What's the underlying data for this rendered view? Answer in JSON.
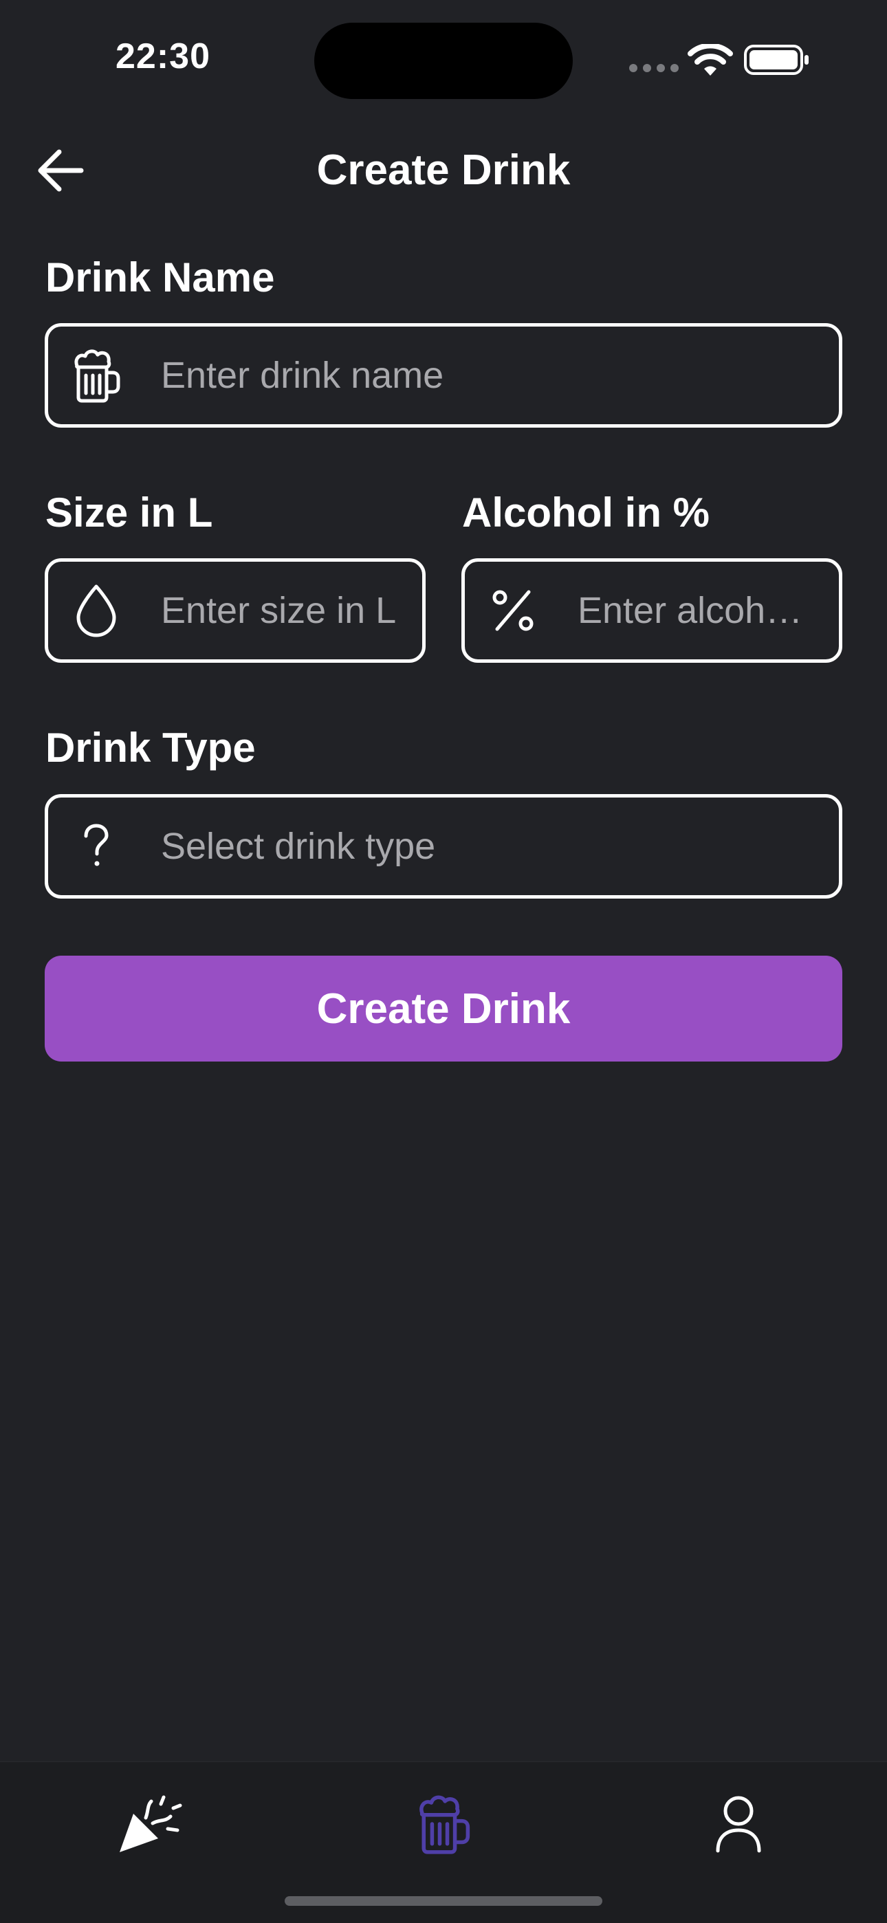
{
  "status_bar": {
    "time": "22:30"
  },
  "nav": {
    "title": "Create Drink",
    "back_icon": "arrow-left-icon"
  },
  "form": {
    "drink_name": {
      "label": "Drink Name",
      "placeholder": "Enter drink name",
      "value": "",
      "icon": "beer-mug-icon"
    },
    "size": {
      "label": "Size in L",
      "placeholder": "Enter size in L",
      "value": "",
      "icon": "droplet-icon"
    },
    "alcohol": {
      "label": "Alcohol in %",
      "placeholder": "Enter alcohol in %",
      "value": "",
      "icon": "percent-icon"
    },
    "drink_type": {
      "label": "Drink Type",
      "placeholder": "Select drink type",
      "icon": "question-mark-icon"
    },
    "submit_label": "Create Drink"
  },
  "tabs": [
    {
      "name": "party",
      "icon": "party-popper-icon",
      "active": false
    },
    {
      "name": "drinks",
      "icon": "beer-mug-icon",
      "active": true
    },
    {
      "name": "profile",
      "icon": "user-icon",
      "active": false
    }
  ],
  "colors": {
    "background": "#212226",
    "accent": "#984fc4",
    "active_tab": "#4f3fa8",
    "placeholder": "#a9a9ad",
    "text": "#ffffff"
  }
}
